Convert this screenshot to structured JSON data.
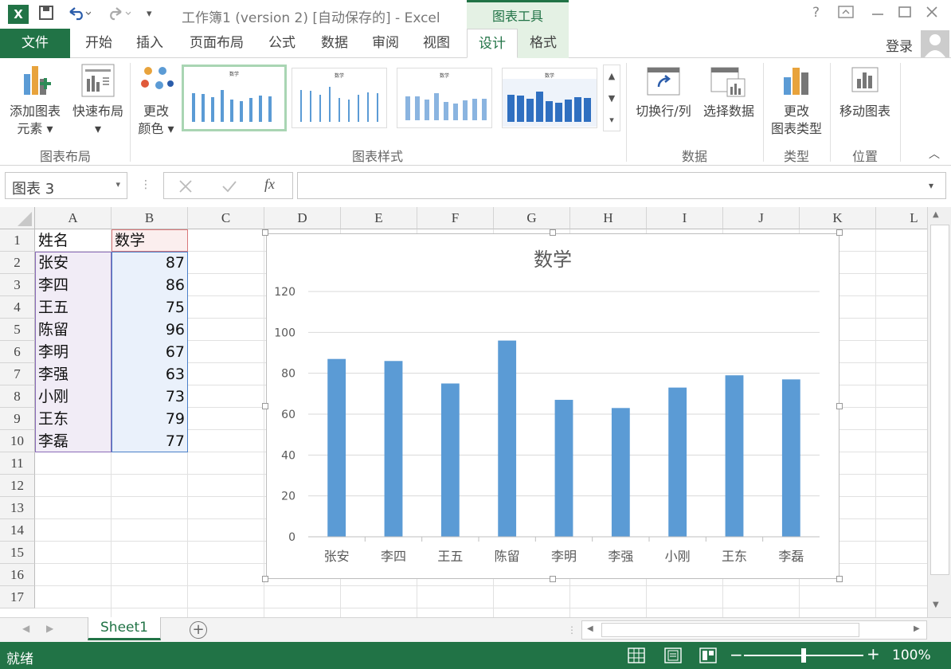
{
  "window": {
    "title": "工作簿1 (version 2) [自动保存的] - Excel",
    "context_tab": "图表工具",
    "help": "?",
    "login": "登录"
  },
  "tabs": [
    "文件",
    "开始",
    "插入",
    "页面布局",
    "公式",
    "数据",
    "审阅",
    "视图",
    "设计",
    "格式"
  ],
  "ribbon": {
    "add_element": [
      "添加图表",
      "元素"
    ],
    "quick_layout": "快速布局",
    "change_color": [
      "更改",
      "颜色"
    ],
    "group_layout": "图表布局",
    "group_styles": "图表样式",
    "switch_rowcol": "切换行/列",
    "select_data": "选择数据",
    "group_data": "数据",
    "change_type": [
      "更改",
      "图表类型"
    ],
    "group_type": "类型",
    "move_chart": "移动图表",
    "group_location": "位置",
    "thumb_title": "数学"
  },
  "formula_bar": {
    "name_box": "图表 3",
    "fx": "fx",
    "value": ""
  },
  "columns": [
    "A",
    "B",
    "C",
    "D",
    "E",
    "F",
    "G",
    "H",
    "I",
    "J",
    "K",
    "L"
  ],
  "rows": [
    "1",
    "2",
    "3",
    "4",
    "5",
    "6",
    "7",
    "8",
    "9",
    "10",
    "11",
    "12",
    "13",
    "14",
    "15",
    "16",
    "17"
  ],
  "table": {
    "headers": [
      "姓名",
      "数学"
    ],
    "rows": [
      [
        "张安",
        "87"
      ],
      [
        "李四",
        "86"
      ],
      [
        "王五",
        "75"
      ],
      [
        "陈留",
        "96"
      ],
      [
        "李明",
        "67"
      ],
      [
        "李强",
        "63"
      ],
      [
        "小刚",
        "73"
      ],
      [
        "王东",
        "79"
      ],
      [
        "李磊",
        "77"
      ]
    ]
  },
  "chart_data": {
    "type": "bar",
    "title": "数学",
    "categories": [
      "张安",
      "李四",
      "王五",
      "陈留",
      "李明",
      "李强",
      "小刚",
      "王东",
      "李磊"
    ],
    "values": [
      87,
      86,
      75,
      96,
      67,
      63,
      73,
      79,
      77
    ],
    "yticks": [
      "0",
      "20",
      "40",
      "60",
      "80",
      "100",
      "120"
    ],
    "ylim": [
      0,
      120
    ],
    "grid": true,
    "bar_color": "#5b9bd5",
    "xlabel": "",
    "ylabel": ""
  },
  "sheets": [
    "Sheet1"
  ],
  "status": {
    "ready": "就绪",
    "zoom": "100%",
    "zoom_value": 100
  },
  "colors": {
    "excel_green": "#217346",
    "context_green": "#e4f1e4",
    "bar_blue": "#5b9bd5"
  }
}
